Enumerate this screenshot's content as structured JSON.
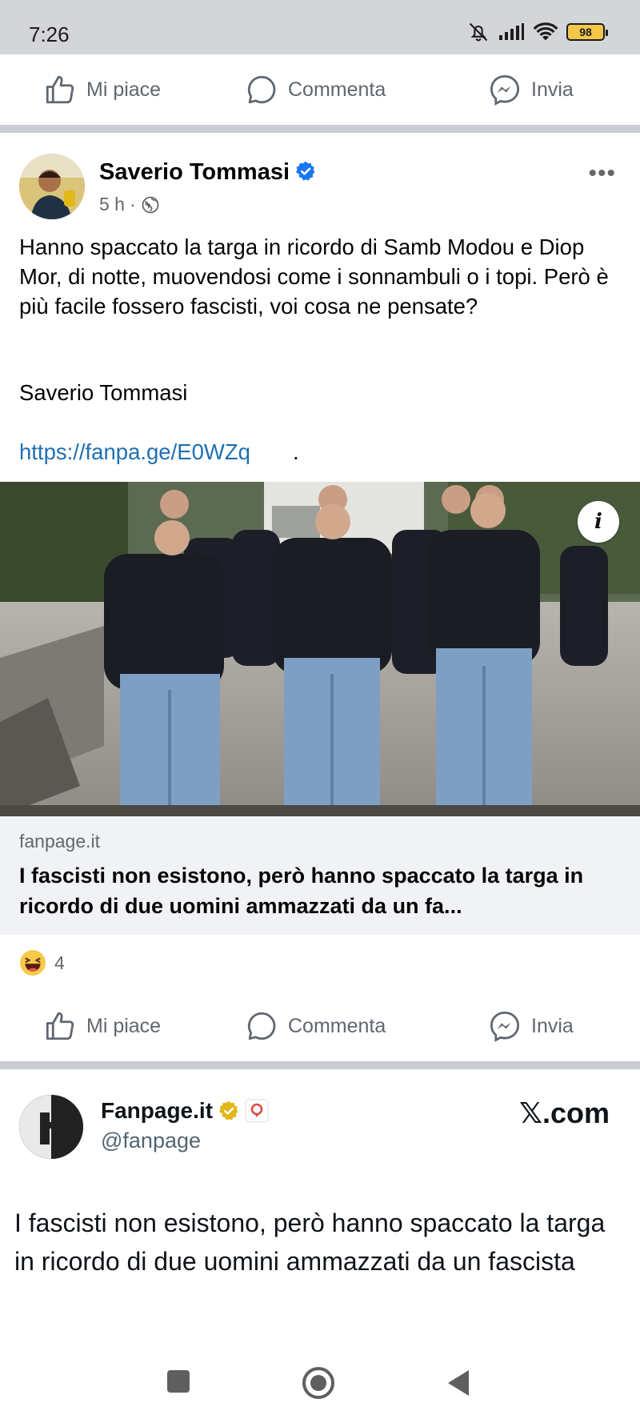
{
  "status_bar": {
    "time": "7:26",
    "battery": "98"
  },
  "top_actions": {
    "like": "Mi piace",
    "comment": "Commenta",
    "send": "Invia"
  },
  "post": {
    "author": "Saverio Tommasi",
    "time": "5 h",
    "text": "Hanno spaccato la targa in ricordo di Samb Modou e Diop Mor, di notte, muovendosi come i sonnambuli o i topi. Però è più facile fossero fascisti, voi cosa ne pensate?",
    "signature": "Saverio Tommasi",
    "link": "https://fanpa.ge/E0WZq",
    "link_suffix": ".",
    "preview": {
      "domain": "fanpage.it",
      "title": "I fascisti non esistono, però hanno spaccato la targa in ricordo di due uomini ammazzati da un fa..."
    },
    "reaction_count": "4"
  },
  "bottom_actions": {
    "like": "Mi piace",
    "comment": "Commenta",
    "send": "Invia"
  },
  "tweet": {
    "name": "Fanpage.it",
    "handle": "@fanpage",
    "brand": "𝕏.com",
    "text": "I fascisti non esistono, però hanno spaccato la targa in ricordo di due uomini ammazzati da un fascista"
  },
  "colors": {
    "facebook_blue": "#1877f2",
    "link_blue": "#1f6fb2",
    "gold_verified": "#e2b719",
    "preview_bg": "#f0f2f5"
  }
}
